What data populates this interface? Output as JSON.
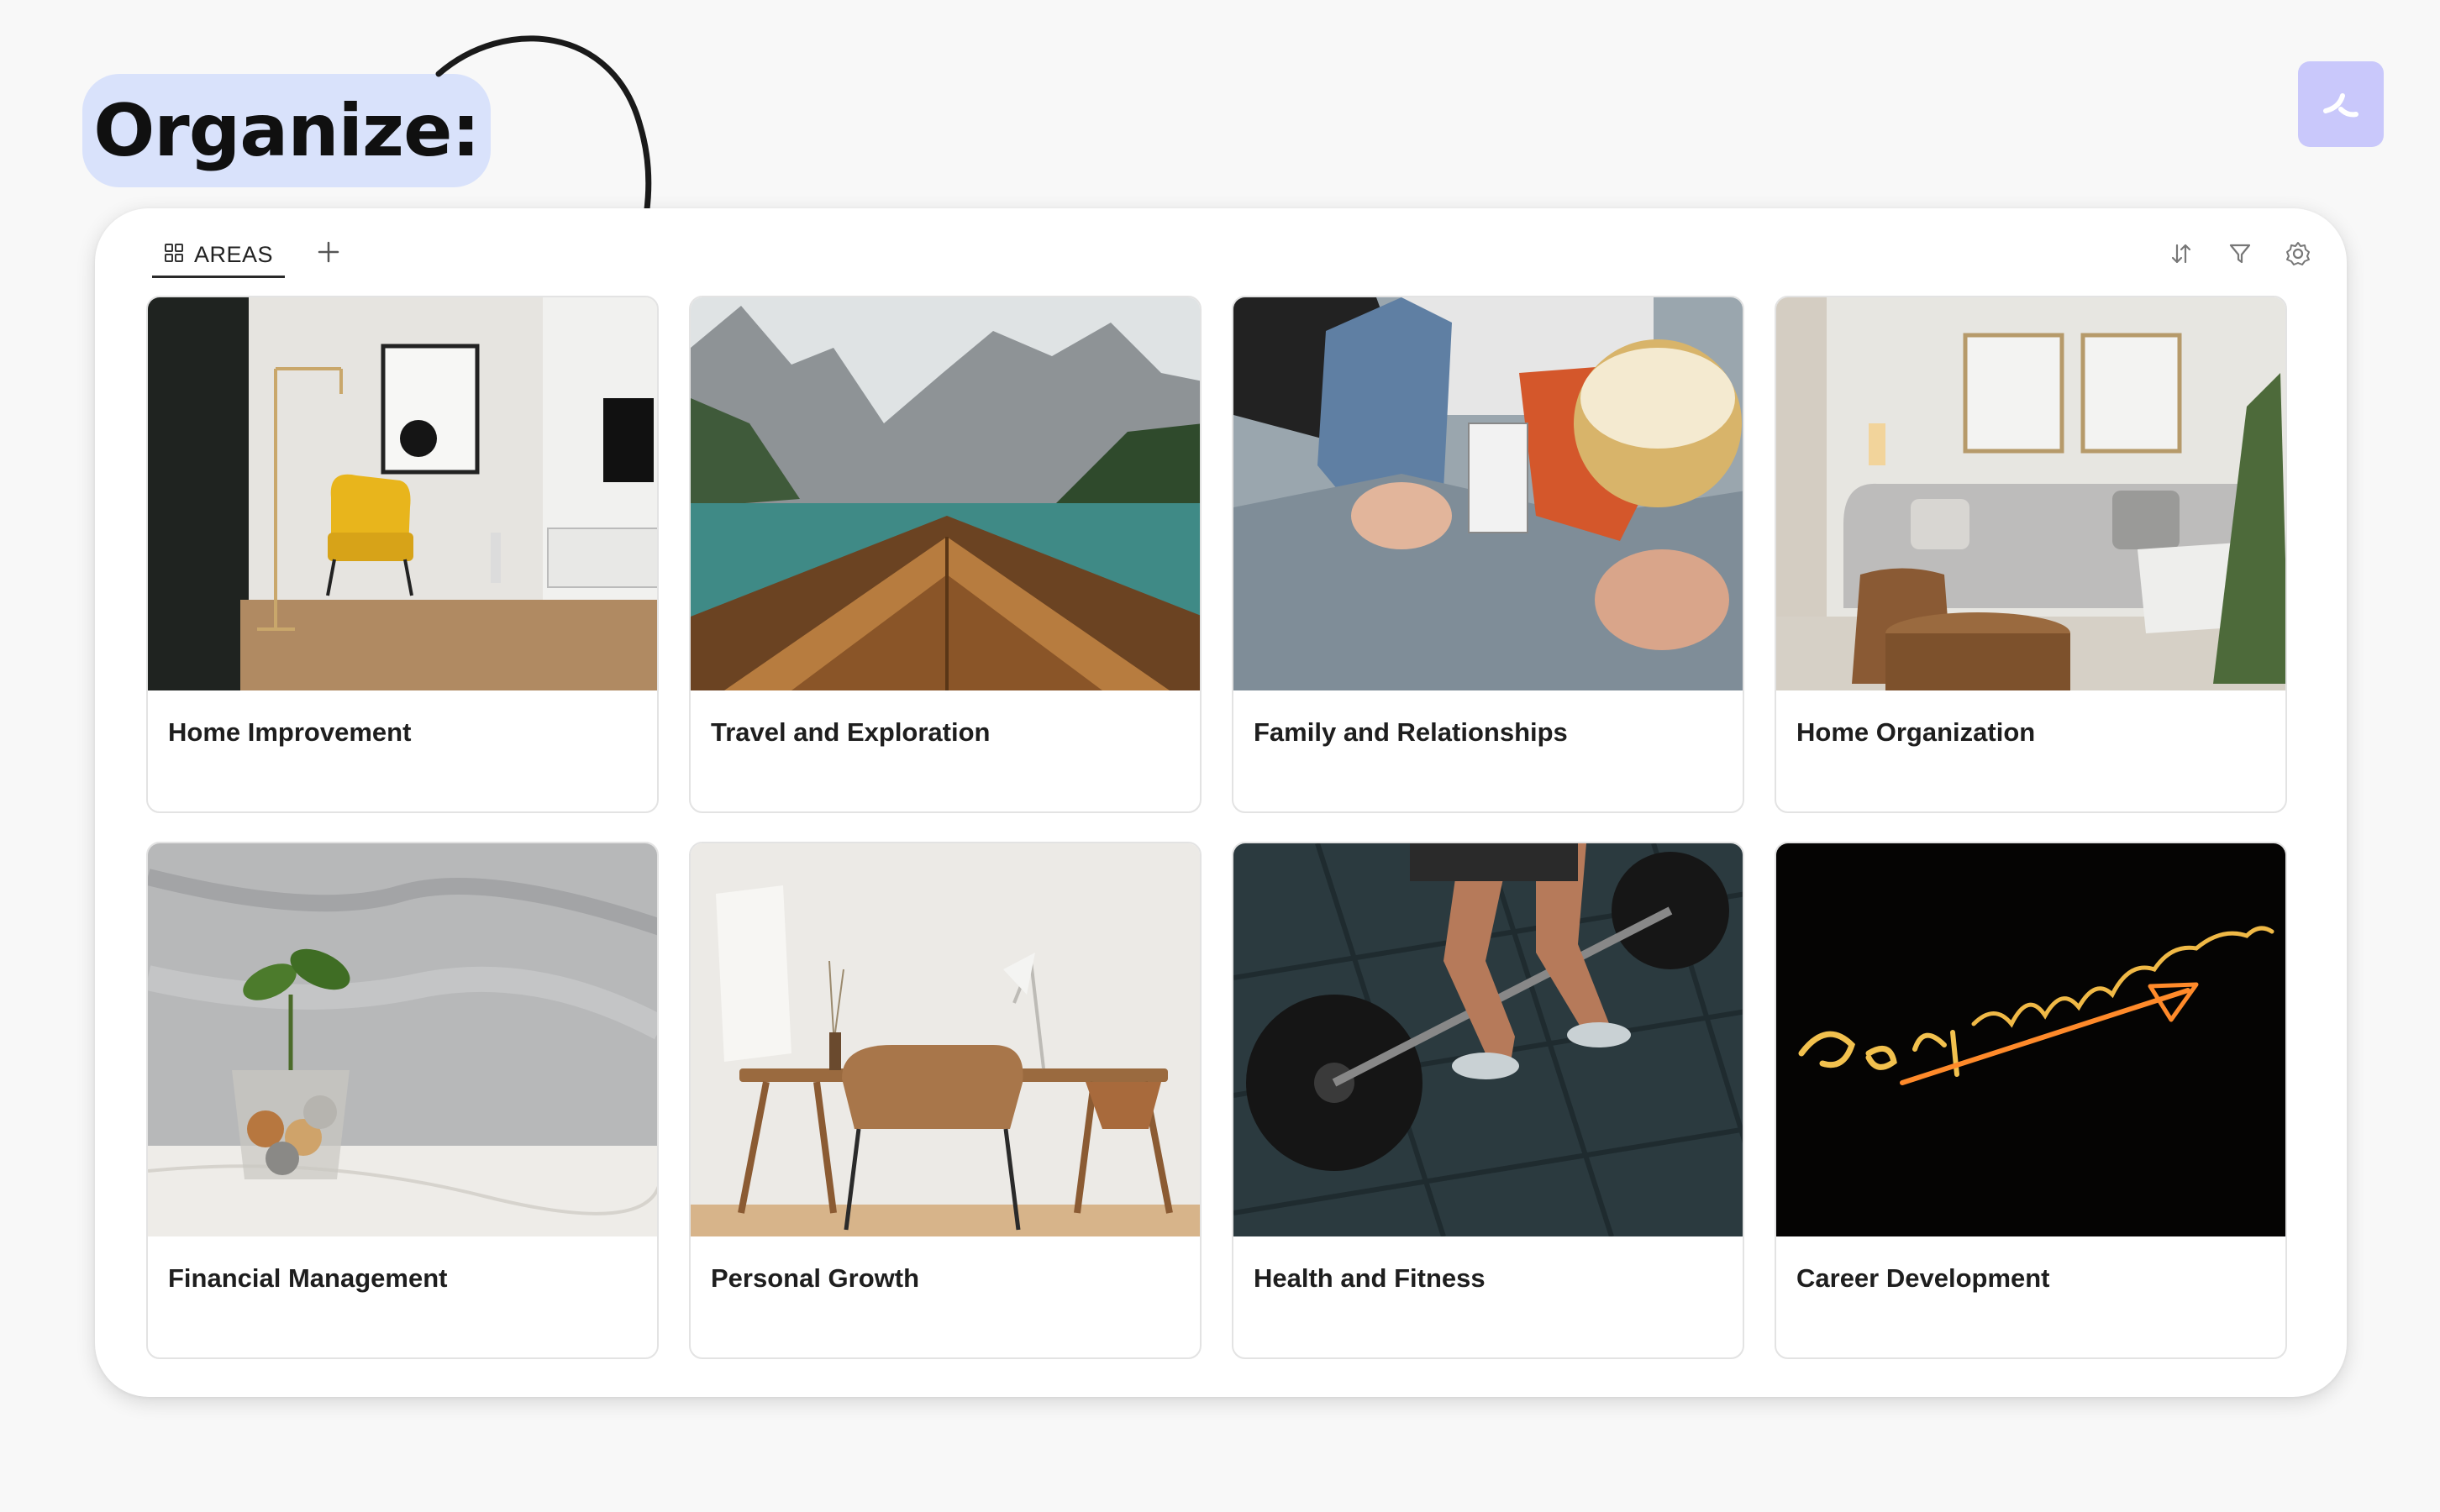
{
  "heading": {
    "label": "Organize:"
  },
  "tabs": [
    {
      "label": "AREAS",
      "icon": "grid-icon"
    }
  ],
  "toolbar": {
    "icons": [
      "sort-icon",
      "filter-icon",
      "settings-icon"
    ]
  },
  "cards": [
    {
      "title": "Home Improvement",
      "image": "living room with yellow armchair"
    },
    {
      "title": "Travel and Exploration",
      "image": "wooden boat on mountain lake"
    },
    {
      "title": "Family and Relationships",
      "image": "people relaxing with popcorn"
    },
    {
      "title": "Home Organization",
      "image": "grey sofa living room"
    },
    {
      "title": "Financial Management",
      "image": "plant growing from coins jar"
    },
    {
      "title": "Personal Growth",
      "image": "minimal desk and chair"
    },
    {
      "title": "Health and Fitness",
      "image": "barbell deadlift"
    },
    {
      "title": "Career Development",
      "image": "neon sign"
    }
  ],
  "colors": {
    "pill": "#d9e2fb",
    "logo": "#c9c8fb",
    "background": "#f8f8f8"
  }
}
